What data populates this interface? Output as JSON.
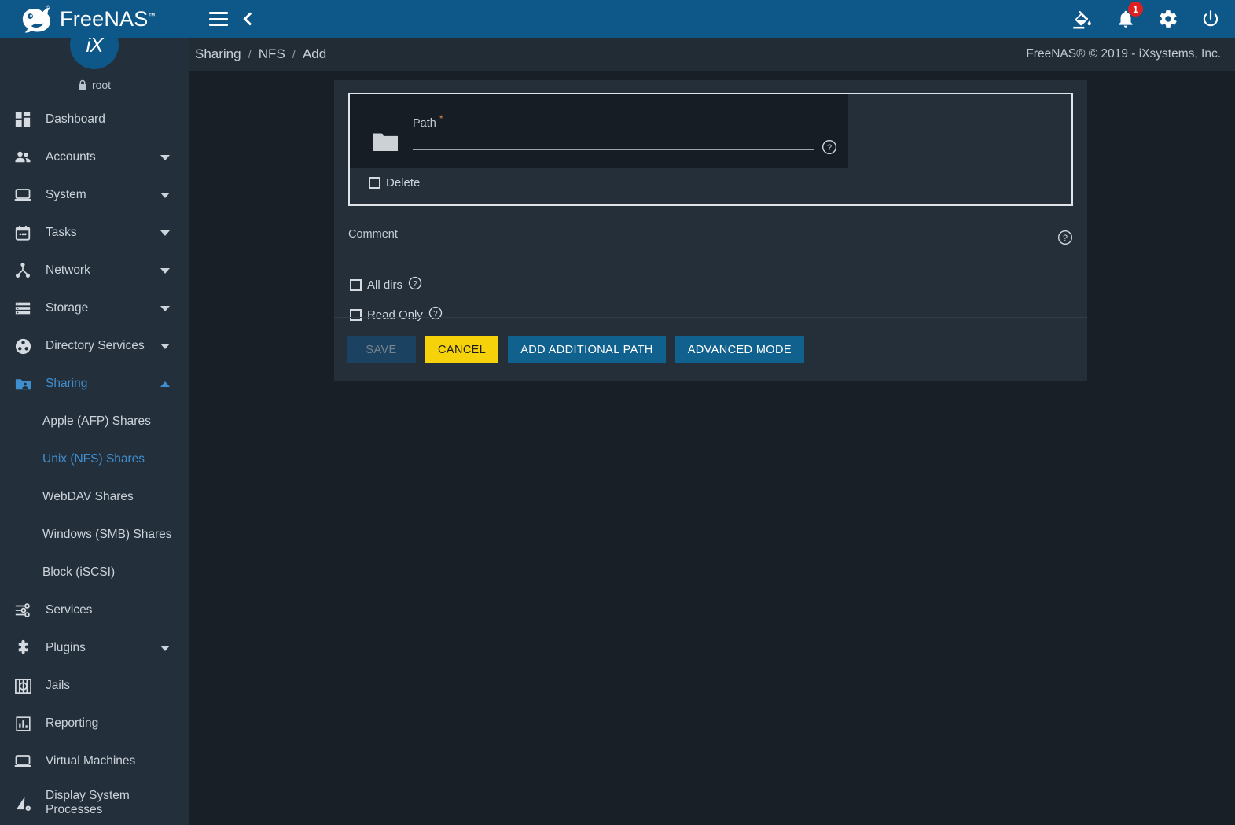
{
  "brand": {
    "name": "FreeNAS",
    "tm": "™",
    "avatar_text": "iX"
  },
  "topbar": {
    "menu_icon": "hamburger-icon",
    "back_icon": "chevron-left-icon",
    "theme_icon": "paint-bucket-icon",
    "notifications_icon": "bell-icon",
    "notifications_count": "1",
    "settings_icon": "gear-icon",
    "power_icon": "power-icon"
  },
  "sidebar": {
    "user": {
      "name": "root",
      "lock_icon": "lock-icon"
    },
    "items": [
      {
        "label": "Dashboard",
        "icon": "dashboard-grid-icon",
        "caret": false,
        "active": false
      },
      {
        "label": "Accounts",
        "icon": "people-icon",
        "caret": true,
        "active": false
      },
      {
        "label": "System",
        "icon": "laptop-icon",
        "caret": true,
        "active": false
      },
      {
        "label": "Tasks",
        "icon": "calendar-icon",
        "caret": true,
        "active": false
      },
      {
        "label": "Network",
        "icon": "network-node-icon",
        "caret": true,
        "active": false
      },
      {
        "label": "Storage",
        "icon": "storage-stack-icon",
        "caret": true,
        "active": false
      },
      {
        "label": "Directory Services",
        "icon": "directory-services-icon",
        "caret": true,
        "active": false
      },
      {
        "label": "Sharing",
        "icon": "shared-folder-icon",
        "caret": true,
        "caret_up": true,
        "active": true
      }
    ],
    "sharing_children": [
      {
        "label": "Apple (AFP) Shares",
        "active": false
      },
      {
        "label": "Unix (NFS) Shares",
        "active": true
      },
      {
        "label": "WebDAV Shares",
        "active": false
      },
      {
        "label": "Windows (SMB) Shares",
        "active": false
      },
      {
        "label": "Block (iSCSI)",
        "active": false
      }
    ],
    "items_after": [
      {
        "label": "Services",
        "icon": "sliders-icon",
        "caret": false
      },
      {
        "label": "Plugins",
        "icon": "puzzle-piece-icon",
        "caret": true
      },
      {
        "label": "Jails",
        "icon": "jail-icon",
        "caret": false
      },
      {
        "label": "Reporting",
        "icon": "bar-chart-icon",
        "caret": false
      },
      {
        "label": "Virtual Machines",
        "icon": "laptop-icon",
        "caret": false
      },
      {
        "label": "Display System Processes",
        "icon": "processes-icon",
        "caret": false
      }
    ]
  },
  "breadcrumb": {
    "items": [
      "Sharing",
      "NFS",
      "Add"
    ],
    "separator": "/",
    "copyright": "FreeNAS® © 2019 - iXsystems, Inc."
  },
  "form": {
    "path": {
      "label": "Path",
      "required_mark": "*",
      "value": "",
      "placeholder": "",
      "folder_icon": "folder-icon",
      "help_icon": "help-circle-icon"
    },
    "delete": {
      "label": "Delete",
      "checked": false
    },
    "comment": {
      "label": "Comment",
      "value": "",
      "placeholder": "",
      "help_icon": "help-circle-icon"
    },
    "all_dirs": {
      "label": "All dirs",
      "checked": false,
      "help_icon": "help-circle-icon"
    },
    "read_only": {
      "label": "Read Only",
      "checked": false,
      "help_icon": "help-circle-icon"
    }
  },
  "buttons": {
    "save": "SAVE",
    "cancel": "CANCEL",
    "add_additional_path": "ADD ADDITIONAL PATH",
    "advanced_mode": "ADVANCED MODE"
  },
  "colors": {
    "topbar_blue": "#0d5789",
    "sidebar_bg": "#232f3b",
    "page_bg": "#181f27",
    "card_bg": "#242f3a",
    "accent_blue": "#3f8fd0",
    "button_blue": "#11618f",
    "cancel_yellow": "#f5d20a",
    "badge_red": "#e02020",
    "required_star": "#c98a4b"
  }
}
